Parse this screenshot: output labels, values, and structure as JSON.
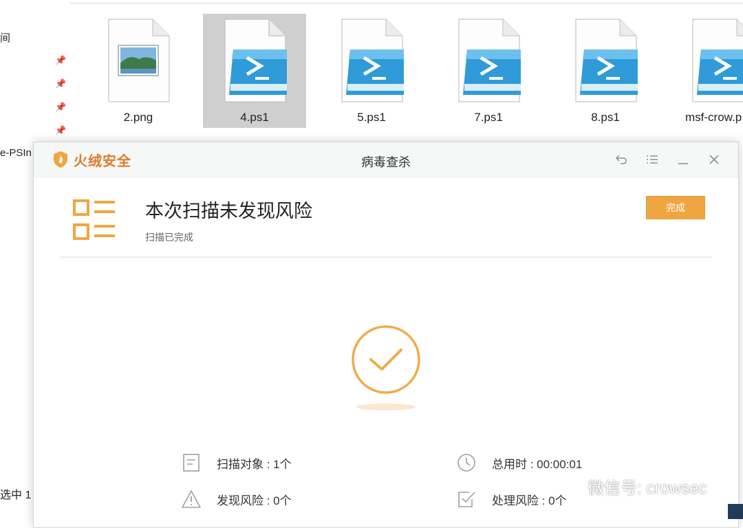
{
  "explorer": {
    "nav_fragments": [
      "间",
      "e-PSIn"
    ],
    "status": "选中 1",
    "files": [
      {
        "name": "2.png",
        "type": "image"
      },
      {
        "name": "4.ps1",
        "type": "powershell",
        "selected": true
      },
      {
        "name": "5.ps1",
        "type": "powershell"
      },
      {
        "name": "7.ps1",
        "type": "powershell"
      },
      {
        "name": "8.ps1",
        "type": "powershell"
      },
      {
        "name": "msf-crow.p",
        "type": "powershell"
      }
    ]
  },
  "dialog": {
    "brand": "火绒安全",
    "title": "病毒查杀",
    "result_title": "本次扫描未发现风险",
    "result_subtitle": "扫描已完成",
    "done_label": "完成",
    "stats": {
      "scan_objects": "扫描对象 : 1个",
      "total_time": "总用时 : 00:00:01",
      "risks_found": "发现风险 : 0个",
      "risks_handled": "处理风险 : 0个"
    }
  },
  "watermark": "微信号: crowsec",
  "colors": {
    "accent": "#f0a640",
    "brand": "#e07a2b",
    "check": "#f0ac4a"
  }
}
